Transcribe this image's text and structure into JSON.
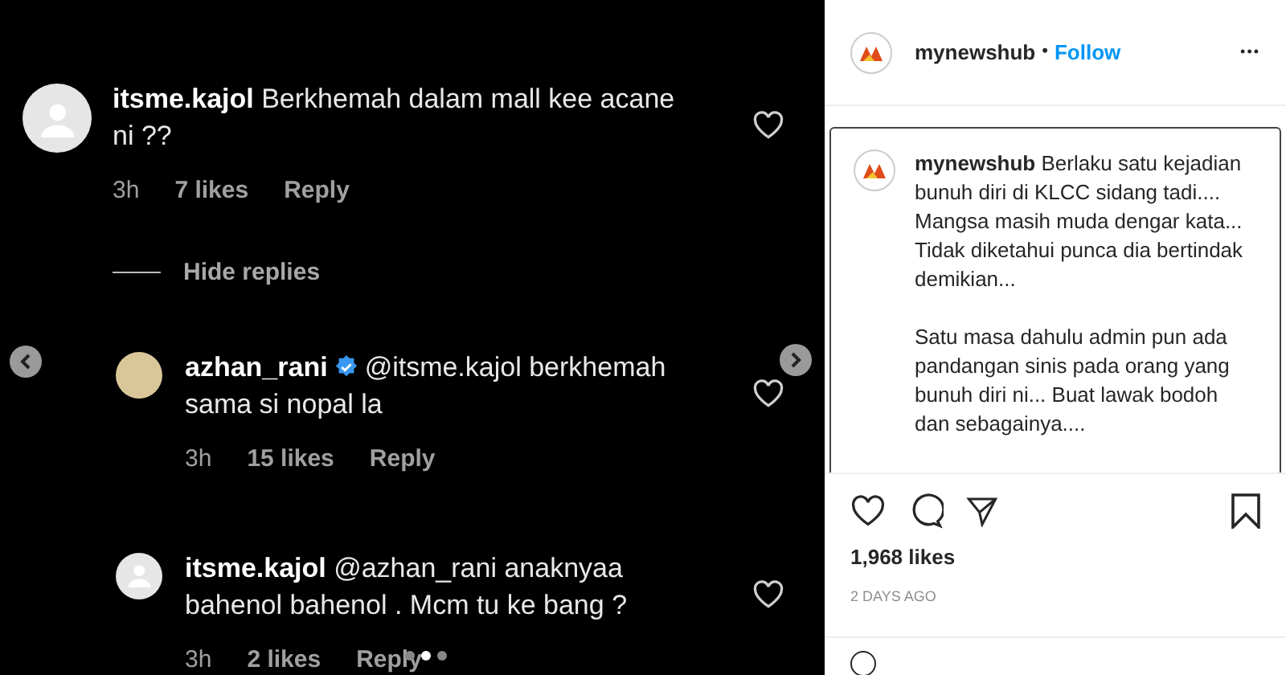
{
  "comments": [
    {
      "username": "itsme.kajol",
      "verified": false,
      "reply": false,
      "text": "Berkhemah dalam mall kee acane ni ??",
      "time": "3h",
      "likes": "7 likes",
      "reply_label": "Reply",
      "avatar_photo": false
    },
    {
      "kind": "toggle",
      "label": "Hide replies"
    },
    {
      "username": "azhan_rani",
      "verified": true,
      "reply": true,
      "text": "@itsme.kajol berkhemah sama si nopal la",
      "time": "3h",
      "likes": "15 likes",
      "reply_label": "Reply",
      "avatar_photo": true
    },
    {
      "username": "itsme.kajol",
      "verified": false,
      "reply": true,
      "text": "@azhan_rani anaknyaa bahenol bahenol . Mcm tu ke bang ?",
      "time": "3h",
      "likes": "2 likes",
      "reply_label": "Reply",
      "avatar_photo": false
    }
  ],
  "carousel_dots": [
    {
      "selected": false
    },
    {
      "selected": true
    },
    {
      "selected": false
    }
  ],
  "post": {
    "account": "mynewshub",
    "separator": "•",
    "follow": "Follow",
    "more": "•••",
    "caption_account": "mynewshub",
    "caption_paragraphs": [
      "Berlaku satu kejadian bunuh diri di KLCC sidang tadi.... Mangsa masih muda dengar kata... Tidak diketahui punca dia bertindak demikian...",
      "Satu masa dahulu admin pun ada pandangan sinis pada orang yang bunuh diri ni... Buat lawak bodoh dan sebagainya...."
    ],
    "likes": "1,968 likes",
    "date": "2 DAYS AGO"
  }
}
